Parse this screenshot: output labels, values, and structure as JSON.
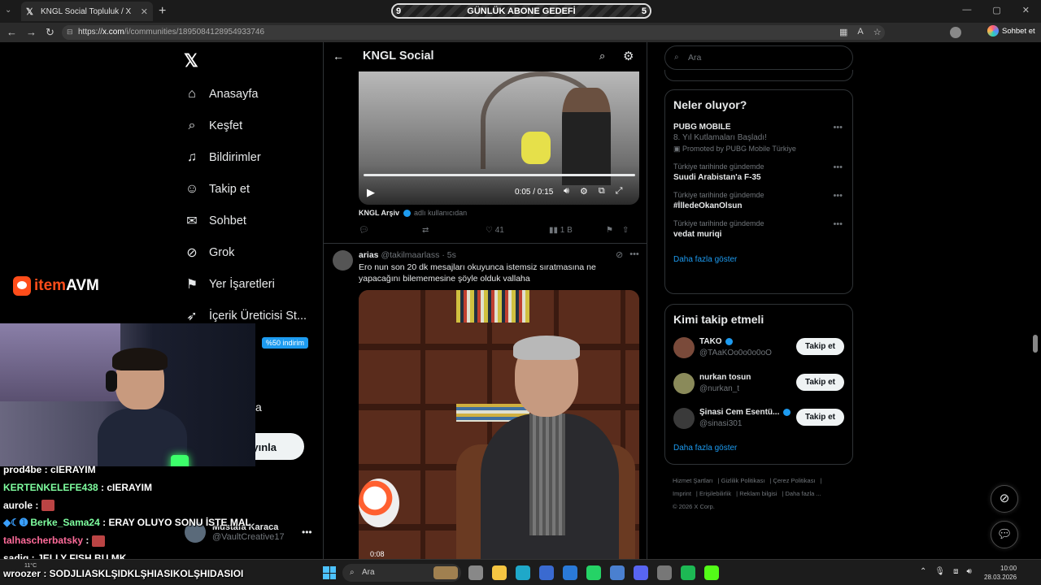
{
  "browser": {
    "tab_title": "KNGL Social Topluluk / X",
    "url_domain": "x.com",
    "url_path": "/i/communities/1895084128954933746",
    "url_prefix": "https://",
    "chat_button": "Sohbet et"
  },
  "stream_overlay": {
    "banner_left": "9",
    "banner_text": "GÜNLÜK ABONE GEDEFİ",
    "banner_right": "5",
    "sponsor_item": "item",
    "sponsor_avm": "AVM",
    "chat": [
      {
        "user": "prod4be",
        "msg": "cIERAYIM",
        "color": "#ffffff"
      },
      {
        "user": "KERTENKELEFE438",
        "msg": "cIERAYIM",
        "color": "#7fffa0"
      },
      {
        "user": "aurole",
        "msg": "",
        "color": "#ffffff"
      },
      {
        "user": "Berke_Sama24",
        "msg": "ERAY OLUYO SONU İSTE MAL",
        "color": "#7fffa0"
      },
      {
        "user": "talhascherbatsky",
        "msg": "",
        "color": "#ff6b9a"
      },
      {
        "user": "sadiq",
        "msg": "JELLY FISH BU MK",
        "color": "#ffffff"
      }
    ],
    "chat_last": "wroozer : SODJLIASKLŞIDKLŞHIASIKOLŞHIDASIOI"
  },
  "x": {
    "nav": [
      {
        "label": "Anasayfa",
        "icon": "home-icon",
        "glyph": "⌂"
      },
      {
        "label": "Keşfet",
        "icon": "search-icon",
        "glyph": "⌕"
      },
      {
        "label": "Bildirimler",
        "icon": "bell-icon",
        "glyph": "♫"
      },
      {
        "label": "Takip et",
        "icon": "follow-icon",
        "glyph": "☺"
      },
      {
        "label": "Sohbet",
        "icon": "mail-icon",
        "glyph": "✉"
      },
      {
        "label": "Grok",
        "icon": "grok-icon",
        "glyph": "⊘"
      },
      {
        "label": "Yer İşaretleri",
        "icon": "bookmark-icon",
        "glyph": "⚑"
      },
      {
        "label": "İçerik Üreticisi St...",
        "icon": "rocket-icon",
        "glyph": "➶"
      }
    ],
    "promo_badge": "%50 indirim",
    "partial_nav_text": "a",
    "publish_label": "yınla",
    "account": {
      "name": "Mustafa Karaca",
      "handle": "@VaultCreative17"
    },
    "community_title": "KNGL Social",
    "video1": {
      "time": "0:05 / 0:15",
      "progress": 1.0
    },
    "source_user": "KNGL Arşiv",
    "source_suffix": "adlı kullanıcıdan",
    "post1_stats": {
      "likes": "41",
      "views": "1 B"
    },
    "post2": {
      "name": "arias",
      "handle": "@takilmaarlass",
      "time": "· 5s",
      "text": "Ero nun son 20 dk mesajları okuyunca istemsiz sıratmasına ne yapacağını bilememesine şöyle olduk vallaha",
      "video_time": "0:08"
    },
    "search_placeholder": "Ara",
    "trends_title": "Neler oluyor?",
    "trends": [
      {
        "ctx": "",
        "name": "PUBG MOBILE",
        "sub": "8. Yıl Kutlamaları Başladı!",
        "promoted": "Promoted by PUBG Mobile Türkiye"
      },
      {
        "ctx": "Türkiye tarihinde gündemde",
        "name": "Suudi Arabistan'a F-35",
        "sub": "",
        "promoted": ""
      },
      {
        "ctx": "Türkiye tarihinde gündemde",
        "name": "#İlledeOkanOlsun",
        "sub": "",
        "promoted": ""
      },
      {
        "ctx": "Türkiye tarihinde gündemde",
        "name": "vedat muriqi",
        "sub": "",
        "promoted": ""
      }
    ],
    "show_more": "Daha fazla göster",
    "follow_title": "Kimi takip etmeli",
    "who_to_follow": [
      {
        "name": "TAKO",
        "handle": "@TAaKOo0o0o0oO",
        "button": "Takip et",
        "verified": true
      },
      {
        "name": "nurkan tosun",
        "handle": "@nurkan_t",
        "button": "Takip et",
        "verified": false
      },
      {
        "name": "Şinasi Cem Esentü...",
        "handle": "@sinasi301",
        "button": "Takip et",
        "verified": true
      }
    ],
    "follow_show_more": "Daha fazla göster",
    "footer": [
      "Hizmet Şartları",
      "Gizlilik Politikası",
      "Çerez Politikası",
      "Imprint",
      "Erişilebilirlik",
      "Reklam bilgisi",
      "Daha fazla ...",
      "© 2026 X Corp."
    ]
  },
  "taskbar": {
    "search": "Ara",
    "weather": "11°C",
    "time": "10:00",
    "date": "28.03.2026"
  },
  "colors": {
    "accent": "#1d9bf0",
    "verified": "#1d9bf0",
    "background": "#000000",
    "border": "#2f3336"
  }
}
